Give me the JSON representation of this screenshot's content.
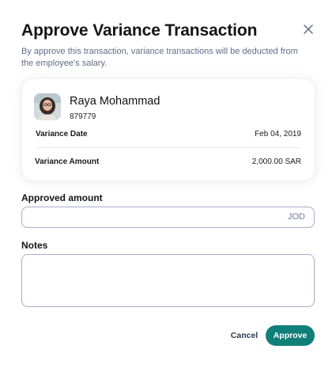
{
  "dialog": {
    "title": "Approve Variance Transaction",
    "subtitle": "By approve this transaction, variance transactions will be deducted from the employee's salary.",
    "close_icon": "close-icon"
  },
  "employee": {
    "name": "Raya Mohammad",
    "id": "879779",
    "avatar_icon": "avatar-photo"
  },
  "details": {
    "variance_date_label": "Variance Date",
    "variance_date_value": "Feb 04, 2019",
    "variance_amount_label": "Variance Amount",
    "variance_amount_value": "2,000.00 SAR"
  },
  "form": {
    "approved_amount_label": "Approved amount",
    "approved_amount_value": "",
    "approved_amount_currency": "JOD",
    "notes_label": "Notes",
    "notes_value": ""
  },
  "actions": {
    "cancel_label": "Cancel",
    "approve_label": "Approve"
  },
  "colors": {
    "accent": "#117f79",
    "subtitle_text": "#5f6d86",
    "input_border": "#a7acd0",
    "currency_text": "#6e7da4"
  }
}
